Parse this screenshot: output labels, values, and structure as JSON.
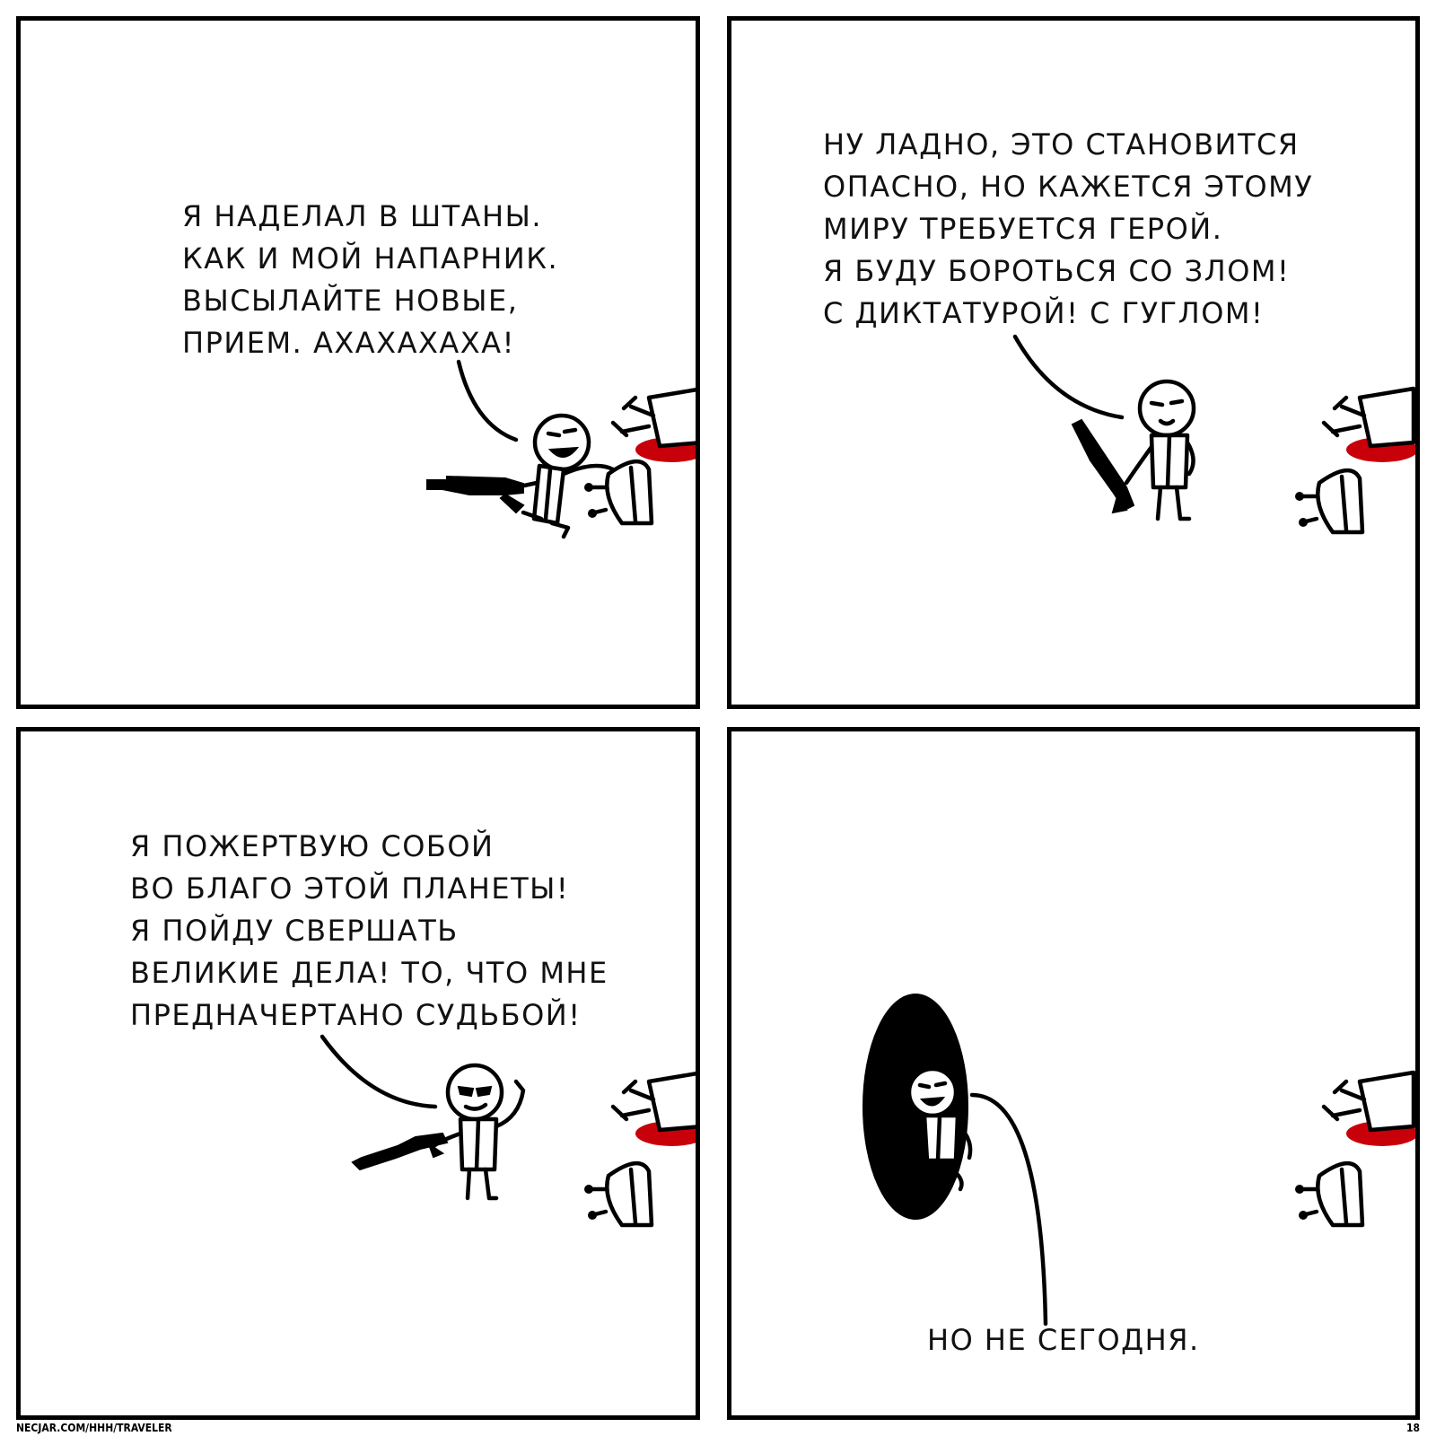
{
  "panels": [
    {
      "id": "panel-1",
      "text": "Я НАДЕЛАЛ В ШТАНЫ.\nКАК И МОЙ НАПАРНИК.\nВЫСЫЛАЙТЕ НОВЫЕ,\nПРИЕМ. АХАХАХАХА!"
    },
    {
      "id": "panel-2",
      "text": "НУ ЛАДНО, ЭТО СТАНОВИТСЯ\nОПАСНО, НО КАЖЕТСЯ ЭТОМУ\nМИРУ ТРЕБУЕТСЯ ГЕРОЙ.\nЯ БУДУ БОРОТЬСЯ СО ЗЛОМ!\nС ДИКТАТУРОЙ! С ГУГЛОМ!"
    },
    {
      "id": "panel-3",
      "text": "Я ПОЖЕРТВУЮ СОБОЙ\nВО БЛАГО ЭТОЙ ПЛАНЕТЫ!\nЯ ПОЙДУ СВЕРШАТЬ\nВЕЛИКИЕ ДЕЛА! ТО, ЧТО МНЕ\nПРЕДНАЧЕРТАНО СУДЬБОЙ!"
    },
    {
      "id": "panel-4",
      "text": "НО НЕ СЕГОДНЯ."
    }
  ],
  "footer": {
    "source": "NECJAR.COM/HHH/TRAVELER",
    "page_number": "18"
  },
  "colors": {
    "ink": "#000000",
    "paper": "#ffffff",
    "blood": "#c8000a"
  }
}
